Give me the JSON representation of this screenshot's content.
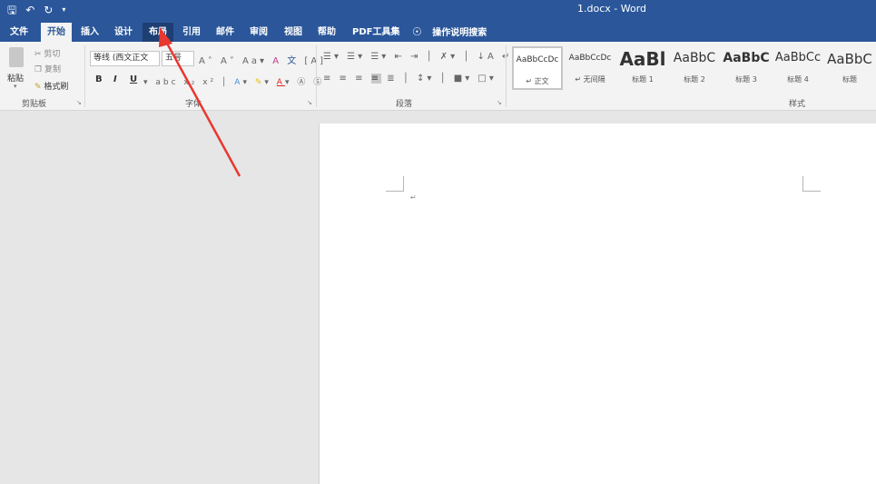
{
  "title_bar": {
    "document_title": "1.docx  -  Word",
    "qat_icons": [
      "save-icon",
      "undo-icon",
      "redo-icon",
      "customize-icon"
    ]
  },
  "tabs": [
    {
      "label": "文件"
    },
    {
      "label": "开始"
    },
    {
      "label": "插入"
    },
    {
      "label": "设计"
    },
    {
      "label": "布局"
    },
    {
      "label": "引用"
    },
    {
      "label": "邮件"
    },
    {
      "label": "审阅"
    },
    {
      "label": "视图"
    },
    {
      "label": "帮助"
    },
    {
      "label": "PDF工具集"
    }
  ],
  "tell_me": "操作说明搜索",
  "clipboard": {
    "paste": "粘贴",
    "cut": "剪切",
    "copy": "复制",
    "format_painter": "格式刷",
    "label": "剪贴板"
  },
  "font": {
    "font_name": "等线 (西文正文",
    "font_size": "五号",
    "label": "字体"
  },
  "paragraph": {
    "label": "段落"
  },
  "styles": {
    "label": "样式",
    "items": [
      {
        "sample": "AaBbCcDc",
        "name": "↵ 正文"
      },
      {
        "sample": "AaBbCcDc",
        "name": "↵ 无间隔"
      },
      {
        "sample": "AaBl",
        "name": "标题 1"
      },
      {
        "sample": "AaBbC",
        "name": "标题 2"
      },
      {
        "sample": "AaBbC",
        "name": "标题 3"
      },
      {
        "sample": "AaBbCc",
        "name": "标题 4"
      },
      {
        "sample": "AaBbC",
        "name": "标题"
      }
    ]
  },
  "document": {
    "paragraph_mark": "↵"
  },
  "colors": {
    "accent": "#2b579a",
    "annotation_arrow": "#e8382f"
  }
}
